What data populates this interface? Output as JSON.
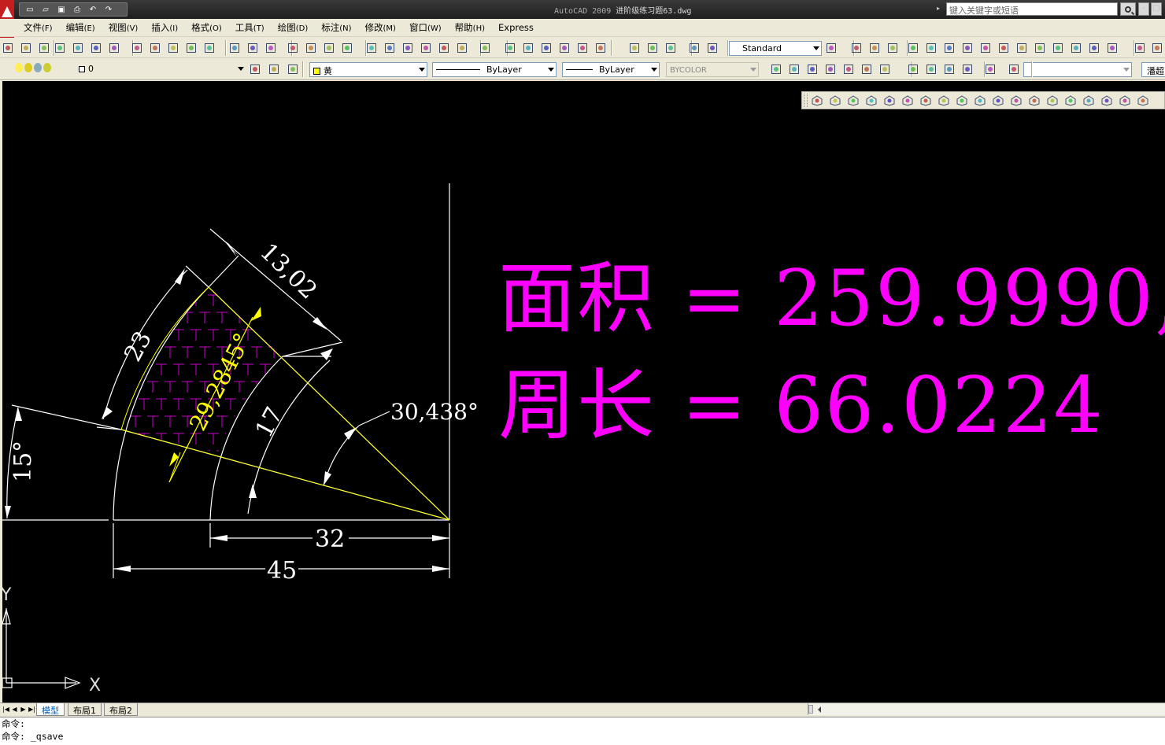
{
  "titlebar": {
    "app_title": "AutoCAD 2009",
    "file_name": "进阶级练习题63.dwg",
    "search_placeholder": "键入关键字或短语",
    "min_symbol": "-",
    "max_symbol": "□"
  },
  "menu": {
    "items": [
      {
        "label": "文件",
        "acc": "(F)"
      },
      {
        "label": "编辑",
        "acc": "(E)"
      },
      {
        "label": "视图",
        "acc": "(V)"
      },
      {
        "label": "插入",
        "acc": "(I)"
      },
      {
        "label": "格式",
        "acc": "(O)"
      },
      {
        "label": "工具",
        "acc": "(T)"
      },
      {
        "label": "绘图",
        "acc": "(D)"
      },
      {
        "label": "标注",
        "acc": "(N)"
      },
      {
        "label": "修改",
        "acc": "(M)"
      },
      {
        "label": "窗口",
        "acc": "(W)"
      },
      {
        "label": "帮助",
        "acc": "(H)"
      },
      {
        "label": "Express",
        "acc": ""
      }
    ]
  },
  "toolbar": {
    "text_style": "Standard",
    "layer": "0",
    "color": "黄",
    "linetype": "ByLayer",
    "lineweight": "ByLayer",
    "plotstyle": "BYCOLOR",
    "right_cut_label": "潘超"
  },
  "drawing": {
    "dim_13_02": "13,02",
    "dim_23": "23",
    "dim_29": "29,2845°",
    "dim_17": "17",
    "dim_30": "30,438°",
    "dim_15": "15°",
    "dim_32": "32",
    "dim_45": "45",
    "ucs_x": "X",
    "ucs_y": "Y",
    "area_line": "面积 = 259.9990,",
    "perimeter_line": "周长 = 66.0224",
    "text_color": "#ff00ff",
    "hatch_color": "#cc00cc",
    "highlight_color": "#ffff00"
  },
  "tabs": [
    {
      "label": "模型",
      "active": true
    },
    {
      "label": "布局1",
      "active": false
    },
    {
      "label": "布局2",
      "active": false
    }
  ],
  "command": {
    "line1": "命令:",
    "line2": "命令: _qsave"
  }
}
